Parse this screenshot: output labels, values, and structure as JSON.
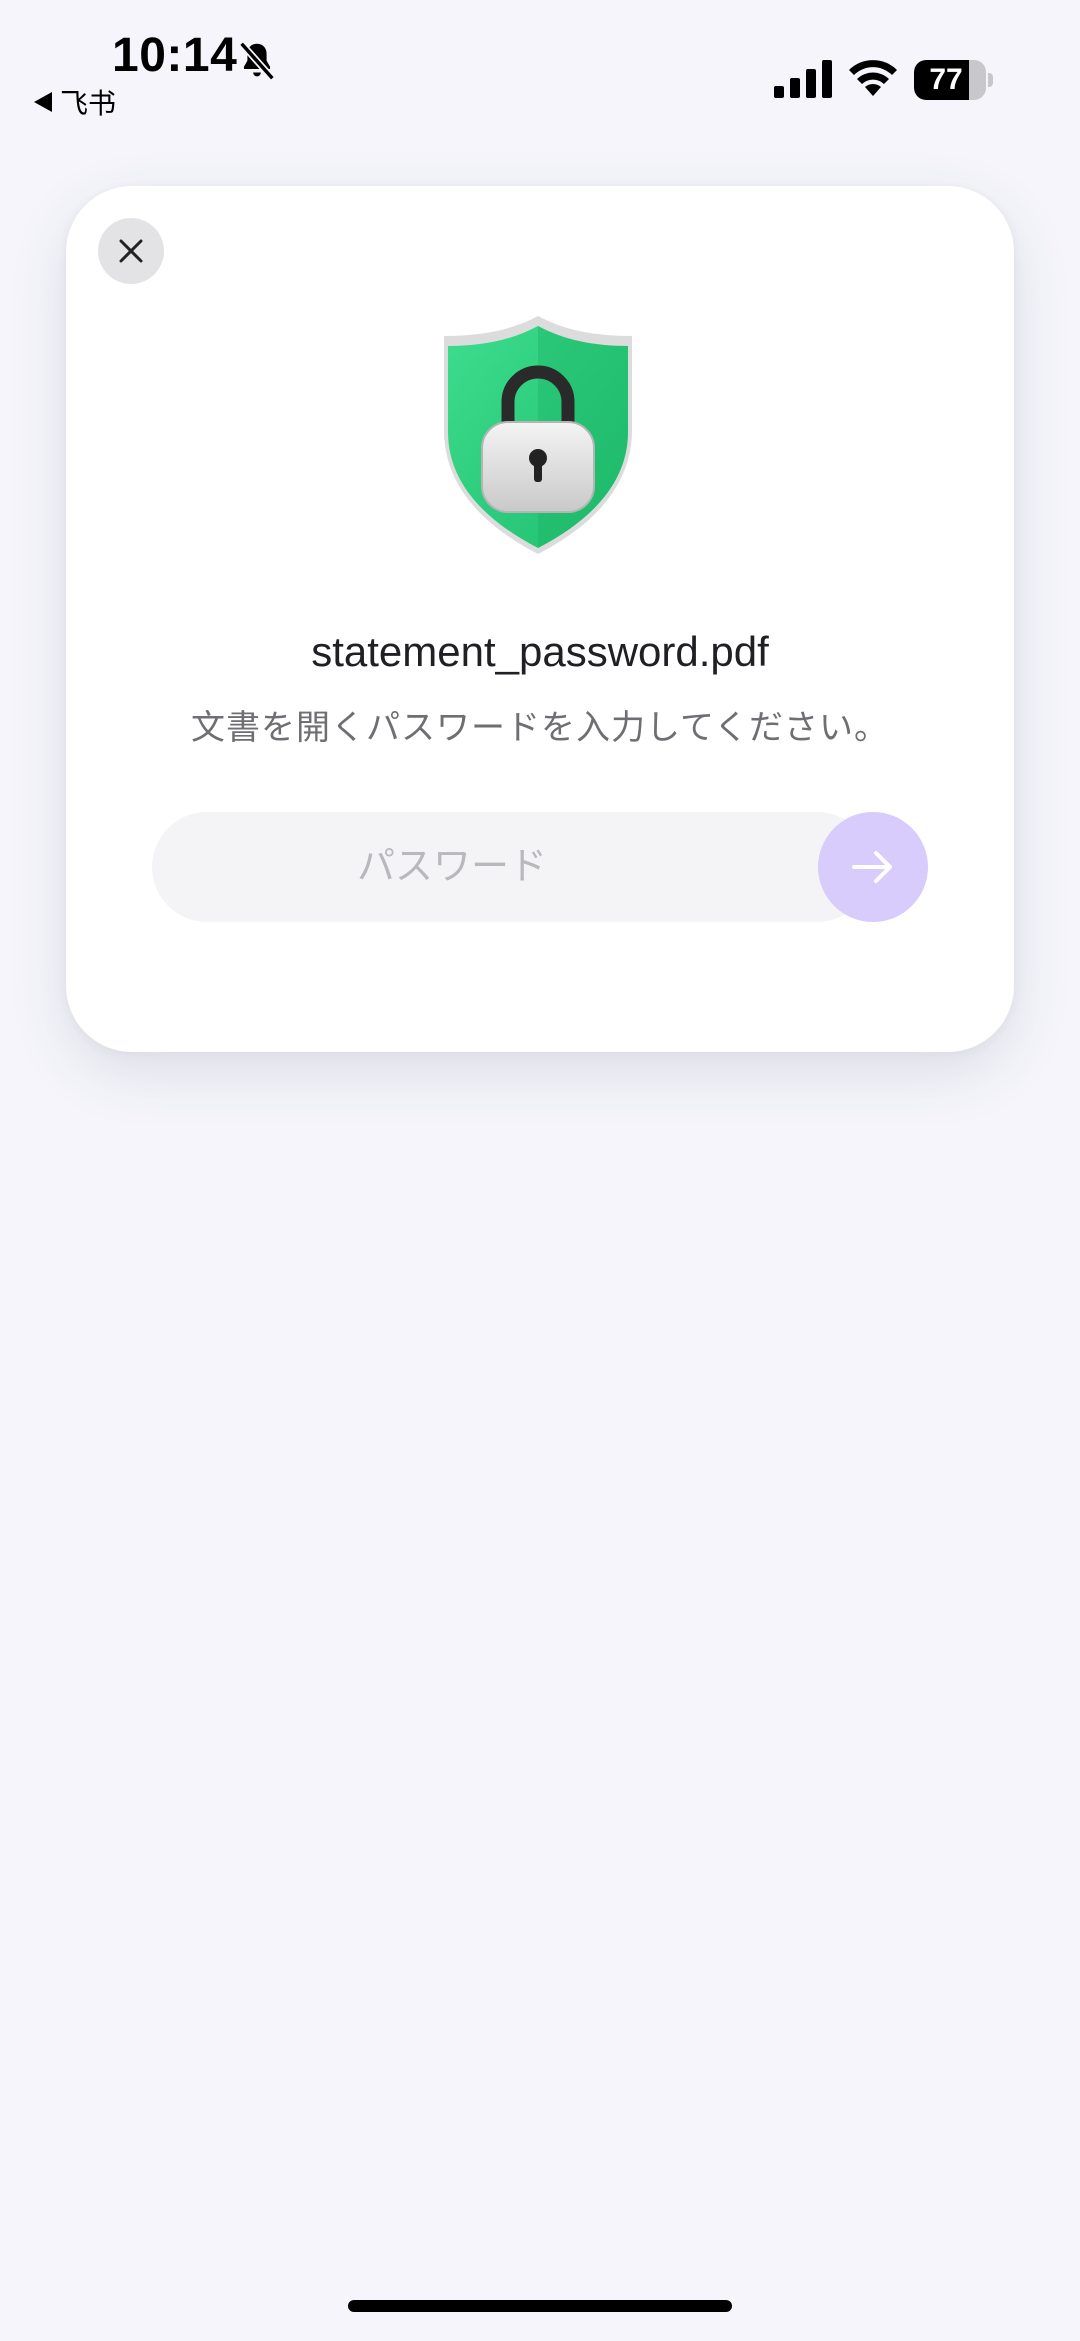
{
  "status_bar": {
    "time": "10:14",
    "back_app": "飞书",
    "battery_level": "77",
    "battery_fraction": 0.77
  },
  "dialog": {
    "filename": "statement_password.pdf",
    "instruction": "文書を開くパスワードを入力してください。",
    "password_placeholder": "パスワード",
    "password_value": ""
  },
  "colors": {
    "background": "#f5f5fb",
    "card": "#ffffff",
    "shield_green": "#2fd080",
    "submit_button": "#d7ccfb",
    "input_background": "#f4f4f6"
  },
  "icons": {
    "bell": "bell-slash-icon",
    "signal": "cellular-signal-icon",
    "wifi": "wifi-icon",
    "close": "close-icon",
    "shield": "shield-lock-icon",
    "submit": "arrow-right-icon"
  }
}
